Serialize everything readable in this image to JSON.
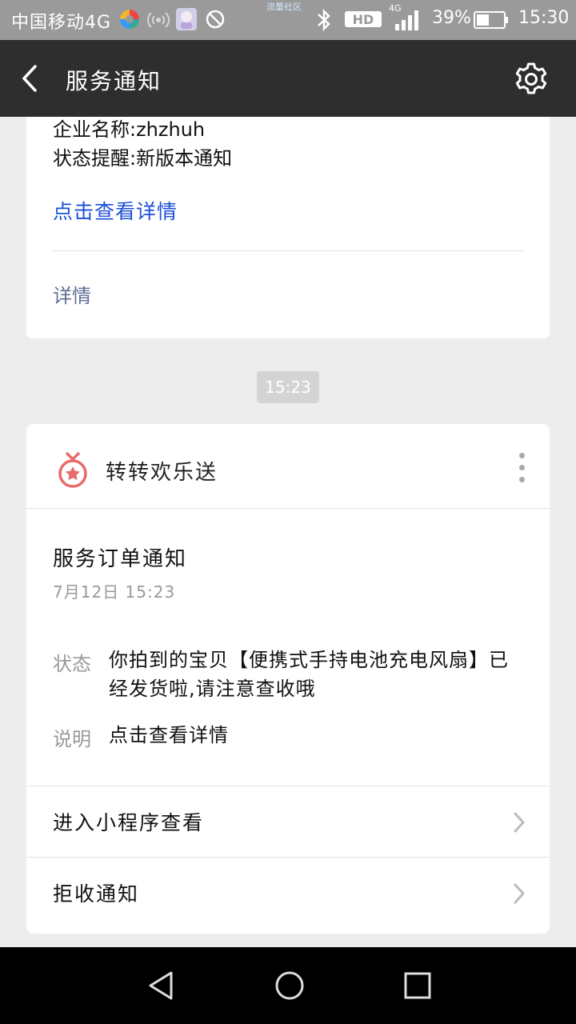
{
  "status_bar": {
    "carrier": "中国移动4G",
    "watermark": "流量社区",
    "network": "HD",
    "signal_type": "4G",
    "battery": "39%",
    "time": "15:30",
    "icons": [
      "app-icon-colorful",
      "wifi-hotspot-icon",
      "avatar-icon",
      "no-disturb-icon",
      "bluetooth-icon",
      "hd-icon",
      "signal-icon",
      "battery-icon"
    ]
  },
  "title_bar": {
    "back_icon": "back-arrow-icon",
    "title": "服务通知",
    "settings_icon": "gear-icon"
  },
  "card1": {
    "company_line": "企业名称:zhzhuh",
    "status_line": "状态提醒:新版本通知",
    "link": "点击查看详情",
    "detail": "详情"
  },
  "timestamp": "15:23",
  "card2": {
    "app_name": "转转欢乐送",
    "logo_icon": "medal-star-icon",
    "more_icon": "more-vertical-icon",
    "title": "服务订单通知",
    "date": "7月12日  15:23",
    "status_label": "状态",
    "status_value": "你拍到的宝贝【便携式手持电池充电风扇】已经发货啦,请注意查收哦",
    "note_label": "说明",
    "note_value": "点击查看详情",
    "rows": [
      {
        "label": "进入小程序查看"
      },
      {
        "label": "拒收通知"
      }
    ]
  },
  "nav_bar": {
    "buttons": [
      "back-triangle-icon",
      "home-circle-icon",
      "recents-square-icon"
    ]
  },
  "colors": {
    "title_bar": "#2e2e2e",
    "link_blue": "#1c4fd6",
    "detail_blue": "#5f6e95",
    "logo_red": "#e86a6a",
    "background": "#ededed"
  }
}
